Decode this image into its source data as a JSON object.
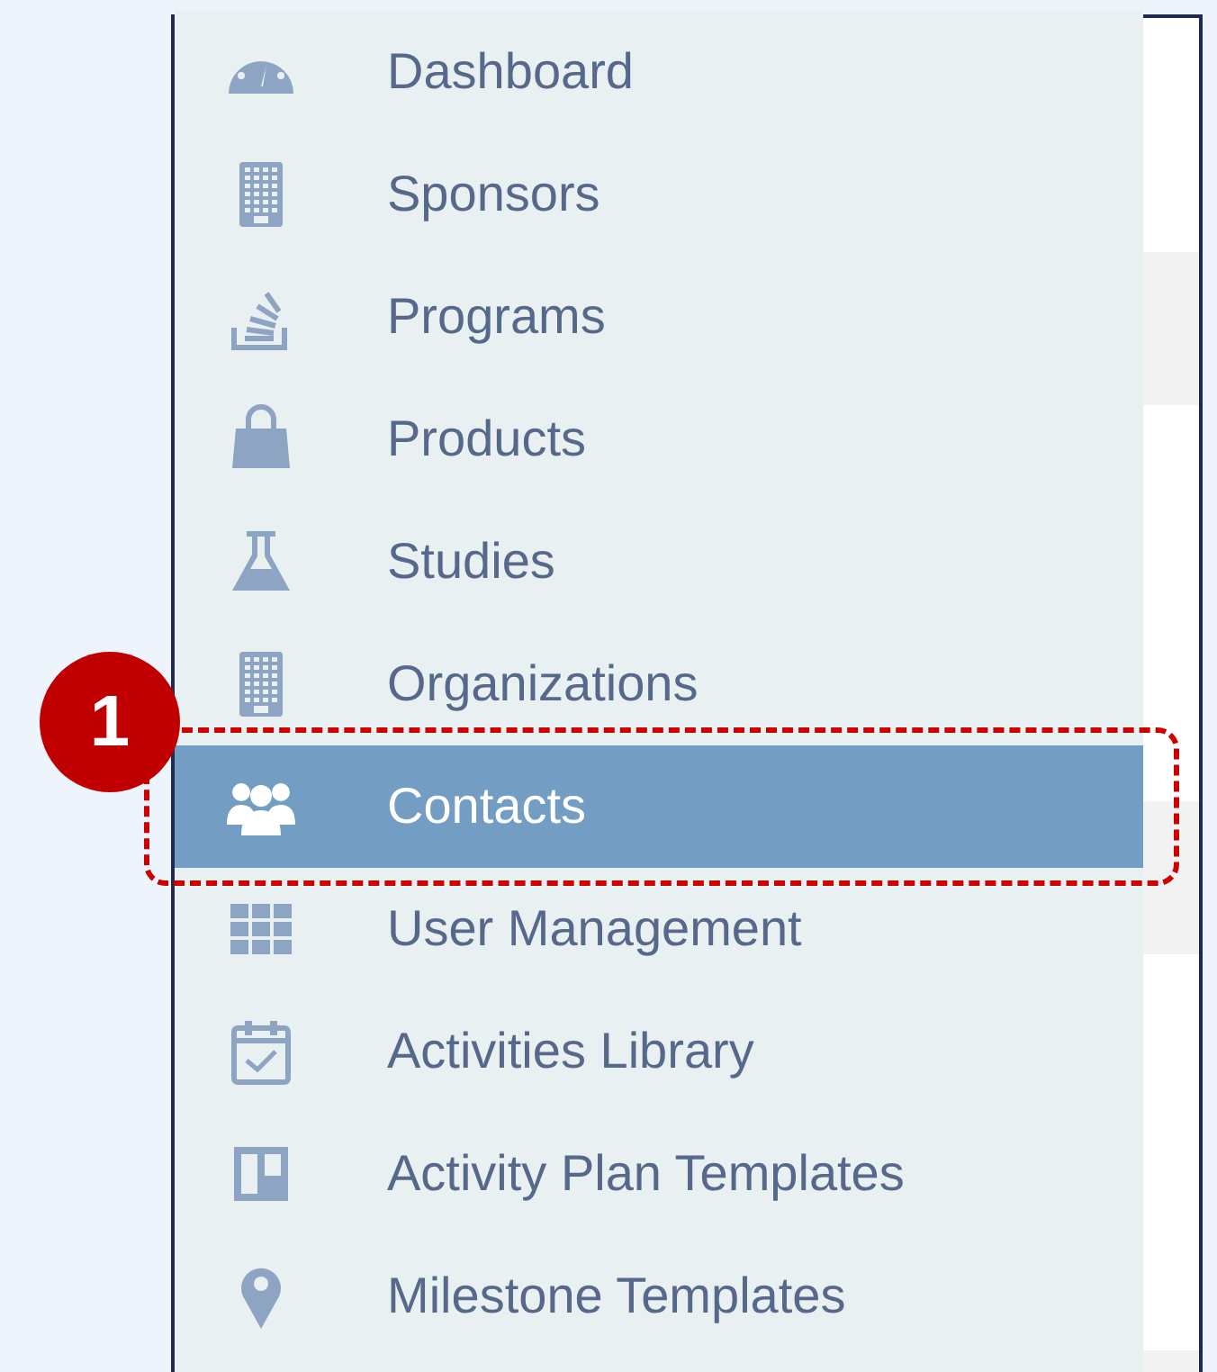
{
  "sidebar": {
    "items": [
      {
        "label": "Dashboard",
        "selected": false
      },
      {
        "label": "Sponsors",
        "selected": false
      },
      {
        "label": "Programs",
        "selected": false
      },
      {
        "label": "Products",
        "selected": false
      },
      {
        "label": "Studies",
        "selected": false
      },
      {
        "label": "Organizations",
        "selected": false
      },
      {
        "label": "Contacts",
        "selected": true
      },
      {
        "label": "User Management",
        "selected": false
      },
      {
        "label": "Activities Library",
        "selected": false
      },
      {
        "label": "Activity Plan Templates",
        "selected": false
      },
      {
        "label": "Milestone Templates",
        "selected": false
      }
    ]
  },
  "annotation": {
    "step": "1"
  }
}
